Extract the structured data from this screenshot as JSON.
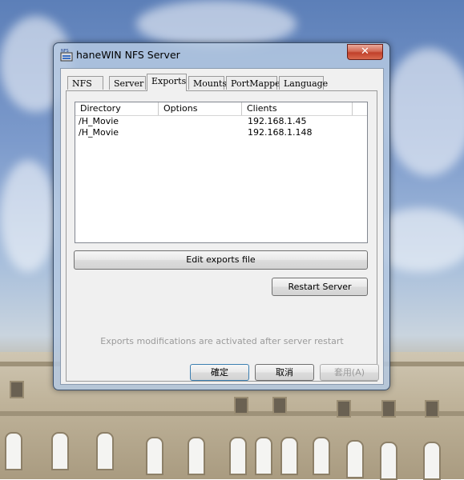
{
  "window": {
    "title": "haneWIN NFS Server",
    "icon_label": "NFS",
    "close_label": "✕"
  },
  "tabs": [
    {
      "label": "NFS",
      "active": false
    },
    {
      "label": "Server",
      "active": false
    },
    {
      "label": "Exports",
      "active": true
    },
    {
      "label": "Mounts",
      "active": false
    },
    {
      "label": "PortMapper",
      "active": false
    },
    {
      "label": "Language",
      "active": false
    }
  ],
  "exports": {
    "columns": [
      "Directory",
      "Options",
      "Clients"
    ],
    "rows": [
      {
        "directory": "/H_Movie",
        "options": "",
        "clients": "192.168.1.45"
      },
      {
        "directory": "/H_Movie",
        "options": "",
        "clients": "192.168.1.148"
      }
    ],
    "edit_button": "Edit exports file",
    "restart_button": "Restart Server",
    "info": "Exports modifications are activated after server restart"
  },
  "footer": {
    "ok": "確定",
    "cancel": "取消",
    "apply": "套用(A)"
  },
  "colors": {
    "close_button": "#c0402a",
    "disabled_text": "#9a9a9a"
  }
}
